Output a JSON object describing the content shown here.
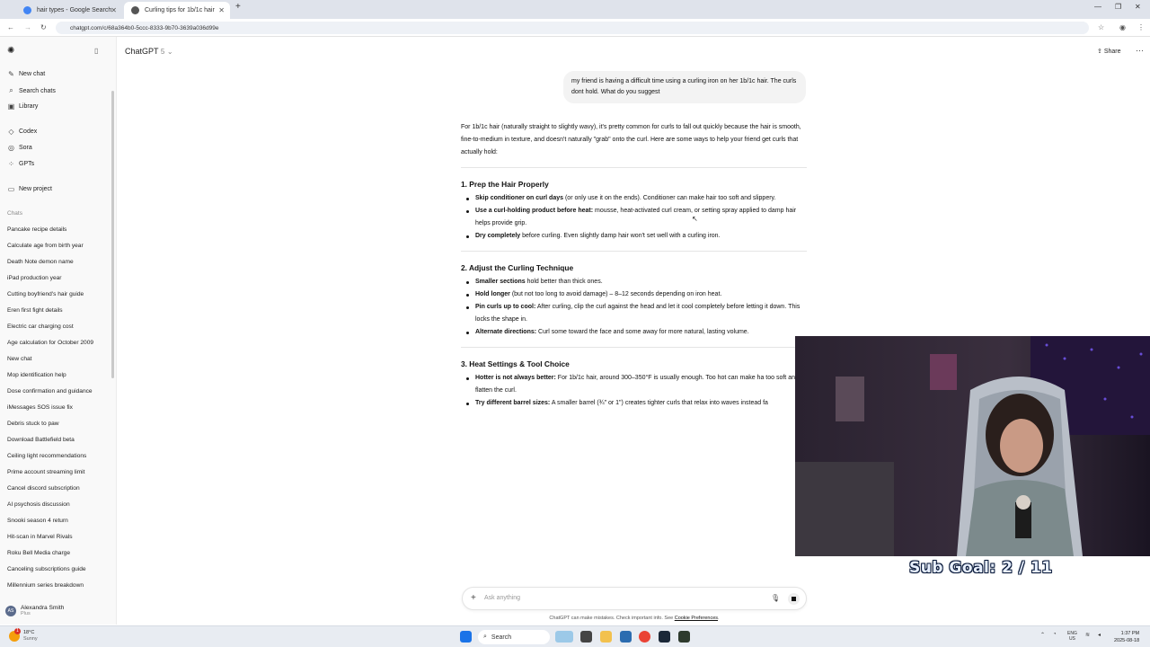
{
  "browser": {
    "tabs": [
      {
        "title": "hair types - Google Search"
      },
      {
        "title": "Curling tips for 1b/1c hair"
      }
    ],
    "url": "chatgpt.com/c/68a364b0-5ccc-8333-9b70-3639a036d99e"
  },
  "sidebar": {
    "top_items": [
      {
        "label": "New chat",
        "icon": "edit-icon"
      },
      {
        "label": "Search chats",
        "icon": "search-icon"
      },
      {
        "label": "Library",
        "icon": "library-icon"
      }
    ],
    "apps": [
      {
        "label": "Codex",
        "icon": "codex-icon"
      },
      {
        "label": "Sora",
        "icon": "sora-icon"
      },
      {
        "label": "GPTs",
        "icon": "gpts-icon"
      }
    ],
    "new_project": "New project",
    "chats_heading": "Chats",
    "chats": [
      "Pancake recipe details",
      "Calculate age from birth year",
      "Death Note demon name",
      "iPad production year",
      "Cutting boyfriend's hair guide",
      "Eren first fight details",
      "Electric car charging cost",
      "Age calculation for October 2009",
      "New chat",
      "Mop identification help",
      "Dose confirmation and guidance",
      "iMessages SOS issue fix",
      "Debris stuck to paw",
      "Download Battlefield beta",
      "Ceiling light recommendations",
      "Prime account streaming limit",
      "Cancel discord subscription",
      "AI psychosis discussion",
      "Snooki season 4 return",
      "Hit-scan in Marvel Rivals",
      "Roku Bell Media charge",
      "Canceling subscriptions guide",
      "Millennium series breakdown"
    ],
    "profile": {
      "initials": "AS",
      "name": "Alexandra Smith",
      "plan": "Plus"
    }
  },
  "header": {
    "model": "ChatGPT",
    "model_version": "5",
    "share": "Share"
  },
  "conversation": {
    "user_message": "my friend is having a difficult time using a curling iron on her 1b/1c hair. The curls dont hold. What do you suggest",
    "intro": "For 1b/1c hair (naturally straight to slightly wavy), it's pretty common for curls to fall out quickly because the hair is smooth, fine-to-medium in texture, and doesn't naturally \"grab\" onto the curl. Here are some ways to help your friend get curls that actually hold:",
    "sections": [
      {
        "heading": "1. Prep the Hair Properly",
        "items": [
          {
            "bold": "Skip conditioner on curl days",
            "text": " (or only use it on the ends). Conditioner can make hair too soft and slippery."
          },
          {
            "bold": "Use a curl-holding product before heat:",
            "text": " mousse, heat-activated curl cream, or setting spray applied to damp hair helps provide grip."
          },
          {
            "bold": "Dry completely",
            "text": " before curling. Even slightly damp hair won't set well with a curling iron."
          }
        ]
      },
      {
        "heading": "2. Adjust the Curling Technique",
        "items": [
          {
            "bold": "Smaller sections",
            "text": " hold better than thick ones."
          },
          {
            "bold": "Hold longer",
            "text": " (but not too long to avoid damage) – 8–12 seconds depending on iron heat."
          },
          {
            "bold": "Pin curls up to cool:",
            "text": " After curling, clip the curl against the head and let it cool completely before letting it down. This locks the shape in."
          },
          {
            "bold": "Alternate directions:",
            "text": " Curl some toward the face and some away for more natural, lasting volume."
          }
        ]
      },
      {
        "heading": "3. Heat Settings & Tool Choice",
        "items": [
          {
            "bold": "Hotter is not always better:",
            "text": " For 1b/1c hair, around 300–350°F is usually enough. Too hot can make ha too soft and flatten the curl."
          },
          {
            "bold": "Try different barrel sizes:",
            "text": " A smaller barrel (¾\" or 1\") creates tighter curls that relax into waves instead fa"
          }
        ]
      }
    ]
  },
  "composer": {
    "placeholder": "Ask anything",
    "disclaimer": "ChatGPT can make mistakes. Check important info. See ",
    "disclaimer_link": "Cookie Preferences",
    "disclaimer_end": "."
  },
  "overlay": {
    "sub_goal": "Sub Goal:  2 / 11"
  },
  "taskbar": {
    "weather_temp": "18°C",
    "weather_desc": "Sunny",
    "notification_count": "1",
    "search": "Search",
    "lang": "ENG",
    "region": "US",
    "time": "1:37 PM",
    "date": "2025-08-18"
  },
  "colors": {
    "tabbar": "#dfe3eb",
    "sidebar": "#f9f9f9",
    "bubble": "#f3f3f3",
    "subgoal_text": "#e8f0ff"
  }
}
